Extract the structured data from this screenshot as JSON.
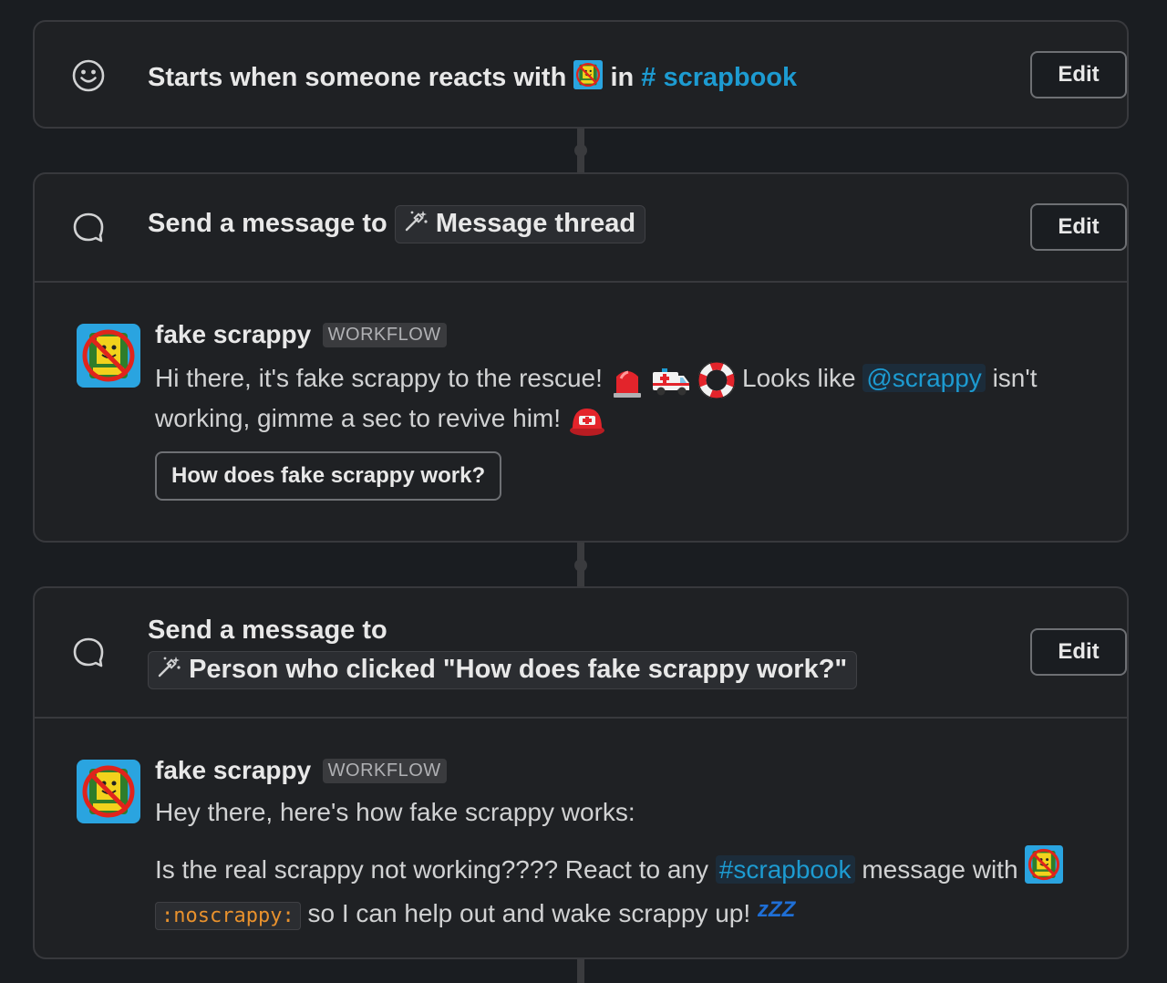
{
  "trigger": {
    "prefix": "Starts when someone reacts with",
    "middle": "in",
    "channel": "# scrapbook",
    "edit_label": "Edit"
  },
  "step1": {
    "title_prefix": "Send a message to",
    "target": "Message thread",
    "edit_label": "Edit",
    "sender": "fake scrappy",
    "badge": "WORKFLOW",
    "text_a": "Hi there, it's fake scrappy to the rescue!",
    "text_b": "Looks like",
    "mention": "@scrappy",
    "text_c": "isn't",
    "text_d": "working, gimme a sec to revive him!",
    "button_label": "How does fake scrappy work?"
  },
  "step2": {
    "title_prefix": "Send a message to",
    "target": "Person who clicked \"How does fake scrappy work?\"",
    "edit_label": "Edit",
    "sender": "fake scrappy",
    "badge": "WORKFLOW",
    "line1": "Hey there, here's how fake scrappy works:",
    "line2_a": "Is the real scrappy not working???? React to any",
    "channel": "#scrapbook",
    "line2_b": "message with",
    "code": ":noscrappy:",
    "line3": "so I can help out and wake scrappy up!",
    "zzz": "zZZ"
  },
  "colors": {
    "background": "#1a1d21",
    "card": "#1f2124",
    "border": "#38393d",
    "link": "#1d9bd1",
    "code": "#e8912d"
  }
}
